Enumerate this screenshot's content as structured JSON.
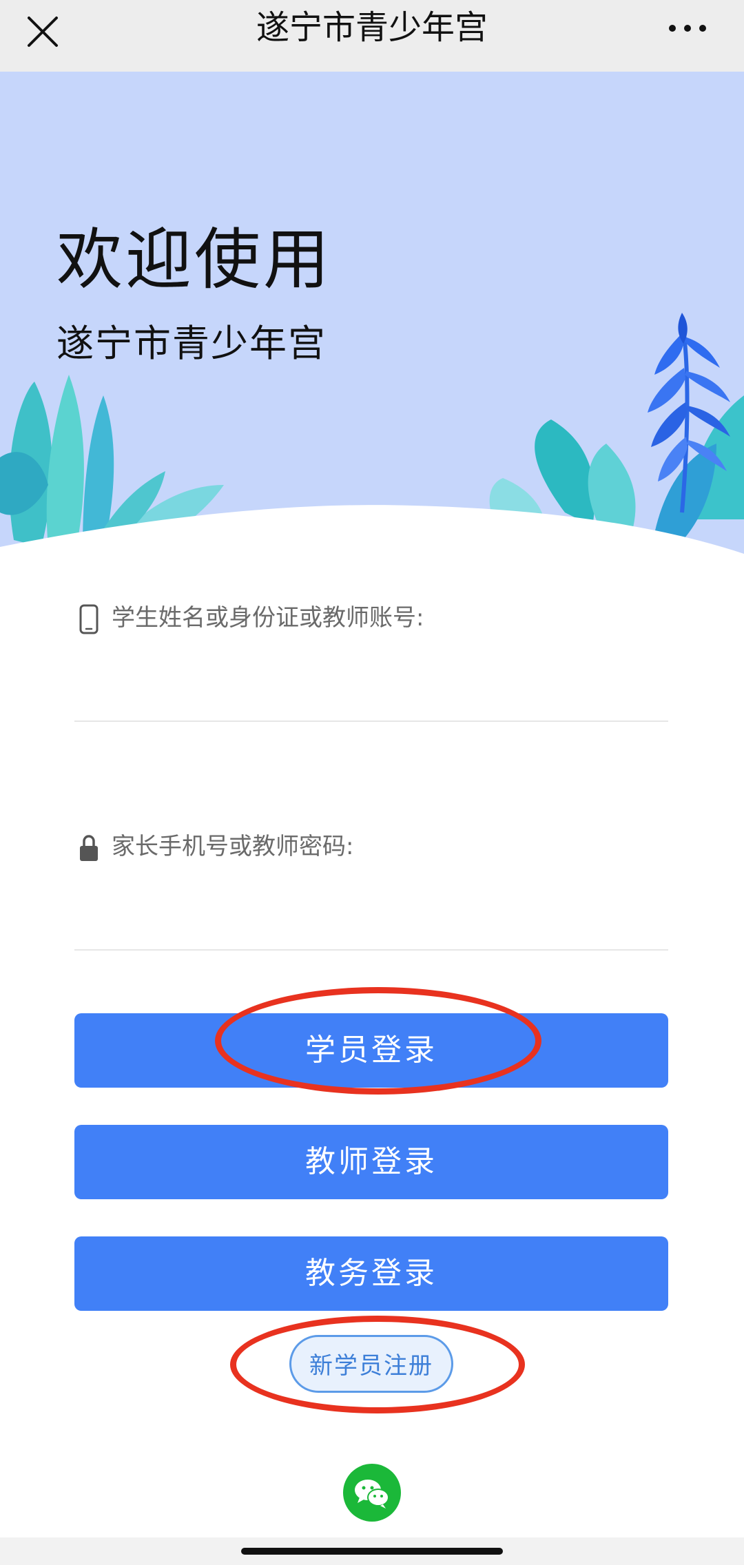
{
  "navbar": {
    "title": "遂宁市青少年宫",
    "close_icon": "close-icon",
    "more_icon": "more-dots-icon"
  },
  "hero": {
    "welcome": "欢迎使用",
    "subtitle": "遂宁市青少年宫",
    "background_color": "#c6d6fb"
  },
  "form": {
    "account": {
      "label": "学生姓名或身份证或教师账号:",
      "icon": "phone-icon",
      "value": ""
    },
    "password": {
      "label": "家长手机号或教师密码:",
      "icon": "lock-icon",
      "value": ""
    }
  },
  "buttons": {
    "student_login": "学员登录",
    "teacher_login": "教师登录",
    "admin_login": "教务登录",
    "new_student_register": "新学员注册"
  },
  "footer": {
    "icon": "wechat-icon"
  },
  "colors": {
    "primary_button": "#4180f7",
    "annotation_red": "#e8321f",
    "register_border": "#5c9be8",
    "wechat_green": "#1bb839"
  }
}
